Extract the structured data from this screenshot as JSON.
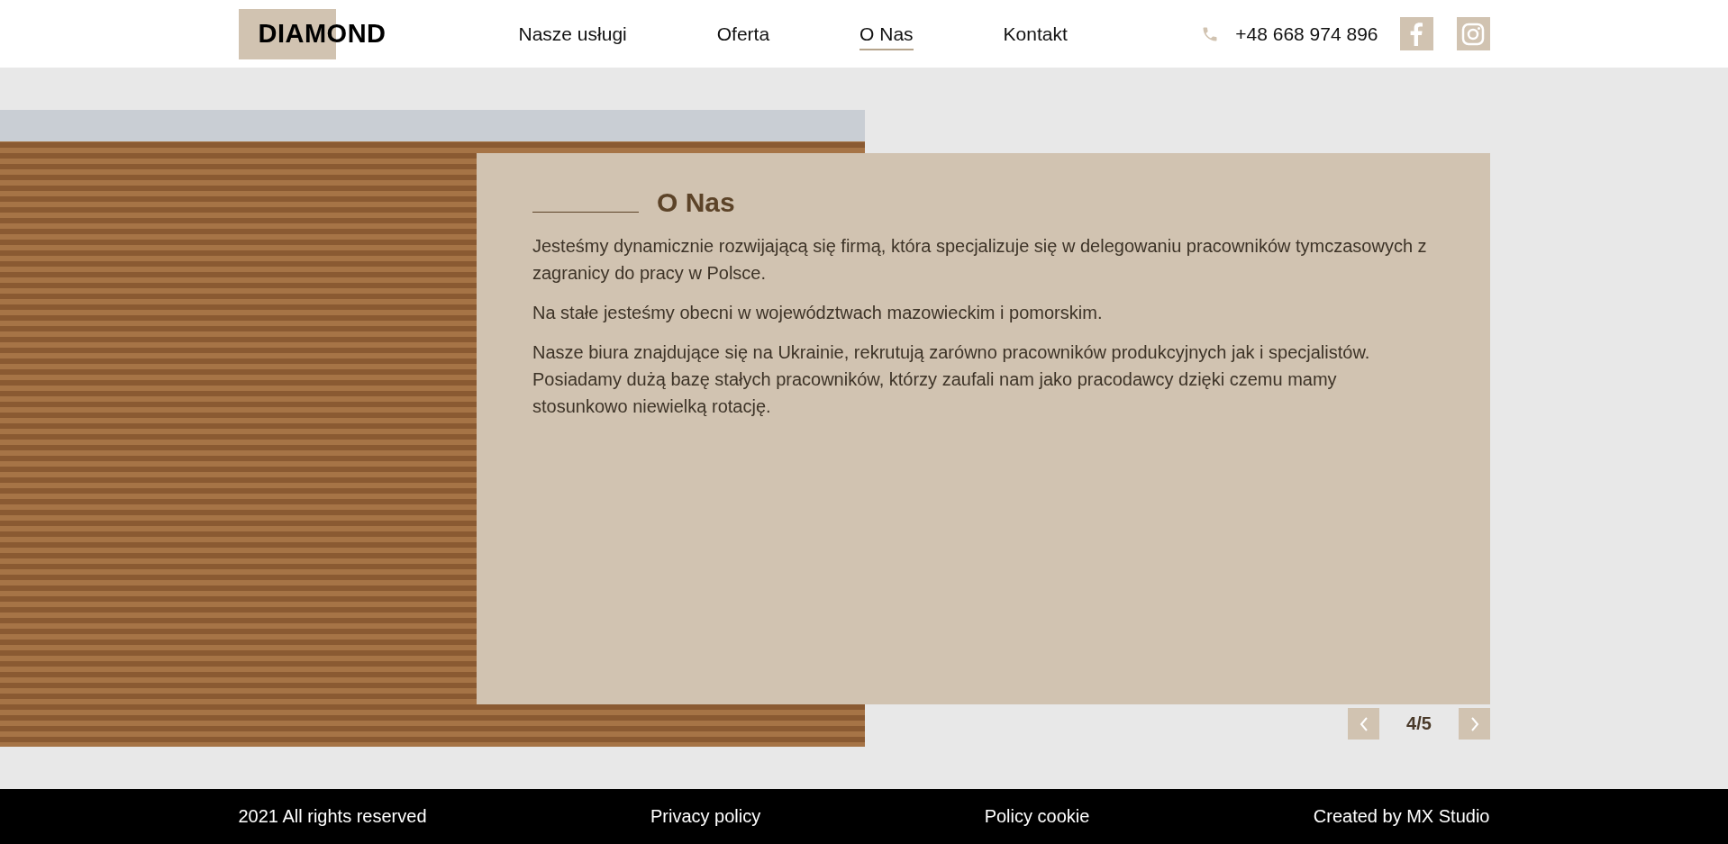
{
  "header": {
    "logo": "DIAMOND",
    "nav": [
      {
        "label": "Nasze usługi",
        "selected": false
      },
      {
        "label": "Oferta",
        "selected": false
      },
      {
        "label": "O Nas",
        "selected": true
      },
      {
        "label": "Kontakt",
        "selected": false
      }
    ],
    "phone": "+48 668 974 896"
  },
  "section": {
    "title": "O Nas",
    "paragraphs": [
      "Jesteśmy dynamicznie rozwijającą się firmą, która specjalizuje się w delegowaniu pracowników tymczasowych z zagranicy do pracy w Polsce.",
      "Na stałe jesteśmy obecni w województwach mazowieckim i pomorskim.",
      "Nasze biura znajdujące się na Ukrainie, rekrutują zarówno pracowników produkcyjnych jak i specjalistów. Posiadamy dużą bazę stałych pracowników, którzy zaufali nam jako pracodawcy dzięki czemu mamy stosunkowo niewielką rotację."
    ],
    "pager": "4/5"
  },
  "footer": [
    "2021 All rights reserved",
    "Privacy policy",
    "Policy cookie",
    "Created by MX Studio"
  ]
}
